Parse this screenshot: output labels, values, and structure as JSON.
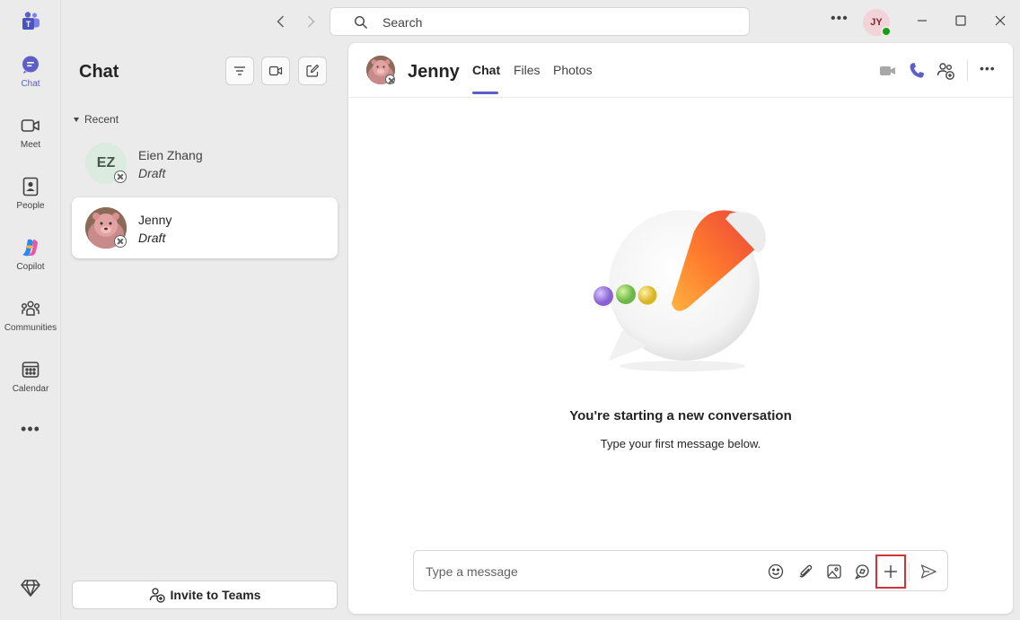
{
  "rail": {
    "items": [
      {
        "label": "Chat",
        "icon": "chat-icon"
      },
      {
        "label": "Meet",
        "icon": "video-icon"
      },
      {
        "label": "People",
        "icon": "people-icon"
      },
      {
        "label": "Copilot",
        "icon": "copilot-icon"
      },
      {
        "label": "Communities",
        "icon": "communities-icon"
      },
      {
        "label": "Calendar",
        "icon": "calendar-icon"
      }
    ],
    "more": "•••"
  },
  "titlebar": {
    "search_placeholder": "Search",
    "more": "•••",
    "user_initials": "JY"
  },
  "chatlist": {
    "title": "Chat",
    "section": "Recent",
    "conversations": [
      {
        "initials": "EZ",
        "name": "Eien Zhang",
        "preview": "Draft"
      },
      {
        "name": "Jenny",
        "preview": "Draft"
      }
    ],
    "invite_label": "Invite to Teams"
  },
  "conversation": {
    "name": "Jenny",
    "tabs": [
      "Chat",
      "Files",
      "Photos"
    ],
    "active_tab": "Chat",
    "more": "•••",
    "empty_title": "You're starting a new conversation",
    "empty_subtitle": "Type your first message below.",
    "composer_placeholder": "Type a message"
  },
  "colors": {
    "accent": "#5b5fc7",
    "highlight": "#d13438",
    "presence_available": "#13a10e"
  }
}
